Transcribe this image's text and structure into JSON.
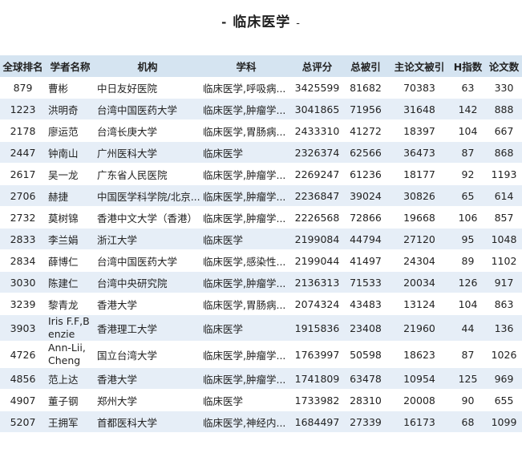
{
  "page": {
    "title": "临床医学",
    "title_prefix": "-",
    "title_suffix": "-"
  },
  "table": {
    "headers": [
      "全球排名",
      "学者名称",
      "机构",
      "学科",
      "总评分",
      "总被引",
      "主论文被引",
      "H指数",
      "论文数"
    ],
    "rows": [
      [
        "879",
        "曹彬",
        "中日友好医院",
        "临床医学,呼吸病...",
        "3425599",
        "81682",
        "70383",
        "63",
        "330"
      ],
      [
        "1223",
        "洪明奇",
        "台湾中国医药大学",
        "临床医学,肿瘤学...",
        "3041865",
        "71956",
        "31648",
        "142",
        "888"
      ],
      [
        "2178",
        "廖运范",
        "台湾长庚大学",
        "临床医学,胃肠病...",
        "2433310",
        "41272",
        "18397",
        "104",
        "667"
      ],
      [
        "2447",
        "钟南山",
        "广州医科大学",
        "临床医学",
        "2326374",
        "62566",
        "36473",
        "87",
        "868"
      ],
      [
        "2617",
        "吴一龙",
        "广东省人民医院",
        "临床医学,肿瘤学...",
        "2269247",
        "61236",
        "18177",
        "92",
        "1193"
      ],
      [
        "2706",
        "赫捷",
        "中国医学科学院/北京...",
        "临床医学,肿瘤学...",
        "2236847",
        "39024",
        "30826",
        "65",
        "614"
      ],
      [
        "2732",
        "莫树锦",
        "香港中文大学（香港）",
        "临床医学,肿瘤学...",
        "2226568",
        "72866",
        "19668",
        "106",
        "857"
      ],
      [
        "2833",
        "李兰娟",
        "浙江大学",
        "临床医学",
        "2199084",
        "44794",
        "27120",
        "95",
        "1048"
      ],
      [
        "2834",
        "薛博仁",
        "台湾中国医药大学",
        "临床医学,感染性...",
        "2199044",
        "41497",
        "24304",
        "89",
        "1102"
      ],
      [
        "3030",
        "陈建仁",
        "台湾中央研究院",
        "临床医学,肿瘤学...",
        "2136313",
        "71533",
        "20034",
        "126",
        "917"
      ],
      [
        "3239",
        "黎青龙",
        "香港大学",
        "临床医学,胃肠病...",
        "2074324",
        "43483",
        "13124",
        "104",
        "863"
      ],
      [
        "3903",
        "Iris F.F,Benzie",
        "香港理工大学",
        "临床医学",
        "1915836",
        "23408",
        "21960",
        "44",
        "136"
      ],
      [
        "4726",
        "Ann-Lii,Cheng",
        "国立台湾大学",
        "临床医学,肿瘤学...",
        "1763997",
        "50598",
        "18623",
        "87",
        "1026"
      ],
      [
        "4856",
        "范上达",
        "香港大学",
        "临床医学,肿瘤学...",
        "1741809",
        "63478",
        "10954",
        "125",
        "969"
      ],
      [
        "4907",
        "董子钢",
        "郑州大学",
        "临床医学",
        "1733982",
        "28310",
        "20008",
        "90",
        "655"
      ],
      [
        "5207",
        "王拥军",
        "首都医科大学",
        "临床医学,神经内...",
        "1684497",
        "27339",
        "16173",
        "68",
        "1099"
      ]
    ]
  }
}
